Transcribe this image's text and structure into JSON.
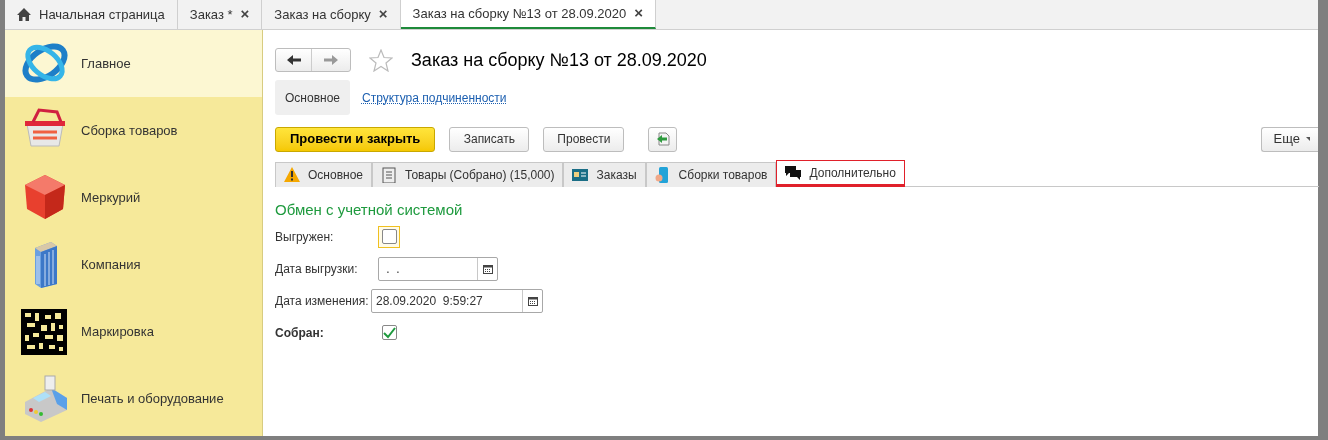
{
  "tabs": [
    {
      "kind": "home",
      "label": "Начальная страница",
      "selected": false
    },
    {
      "kind": "doc",
      "label": "Заказ *",
      "close": "×",
      "selected": false
    },
    {
      "kind": "doc",
      "label": "Заказ на сборку",
      "close": "×",
      "selected": false
    },
    {
      "kind": "doc",
      "label": "Заказ на сборку №13 от 28.09.2020",
      "close": "×",
      "selected": true
    }
  ],
  "sidebar": {
    "items": [
      {
        "kind": "logo",
        "label": "Главное",
        "selected": true
      },
      {
        "kind": "basket",
        "label": "Сборка товаров",
        "selected": false
      },
      {
        "kind": "cube",
        "label": "Меркурий",
        "selected": false
      },
      {
        "kind": "building",
        "label": "Компания",
        "selected": false
      },
      {
        "kind": "code",
        "label": "Маркировка",
        "selected": false
      },
      {
        "kind": "terminal",
        "label": "Печать и оборудование",
        "selected": false
      }
    ]
  },
  "form": {
    "title": "Заказ на сборку №13 от 28.09.2020",
    "favorite": false,
    "sections": [
      {
        "label": "Основное",
        "selected": true
      },
      {
        "label": "Структура подчиненности",
        "selected": false
      }
    ],
    "buttons": [
      {
        "kind": "primary",
        "label": "Провести и закрыть"
      },
      {
        "kind": "default",
        "label": "Записать"
      },
      {
        "kind": "default",
        "label": "Провести"
      },
      {
        "kind": "icon"
      }
    ],
    "more": "Еще",
    "tabs": [
      {
        "kind": "warning",
        "label": "Основное",
        "selected": false,
        "highlighted": false
      },
      {
        "kind": "list",
        "label": "Товары (Собрано) (15,000)",
        "selected": false,
        "highlighted": false
      },
      {
        "kind": "card",
        "label": "Заказы",
        "selected": false,
        "highlighted": false
      },
      {
        "kind": "phone",
        "label": "Сборки товаров",
        "selected": false,
        "highlighted": false
      },
      {
        "kind": "chat",
        "label": "Дополнительно",
        "selected": true,
        "highlighted": true
      }
    ],
    "group_title": "Обмен с учетной системой",
    "fields": [
      {
        "kind": "checkbox",
        "label": "Выгружен:",
        "bold": false,
        "checked": false,
        "focused": true
      },
      {
        "kind": "date",
        "label": "Дата выгрузки:",
        "value": " .  .",
        "bold": false
      },
      {
        "kind": "date",
        "label": "Дата изменения:",
        "value": "28.09.2020  9:59:27",
        "bold": false
      },
      {
        "kind": "checkbox",
        "label": "Собран:",
        "bold": true,
        "checked": true,
        "focused": false
      }
    ]
  }
}
